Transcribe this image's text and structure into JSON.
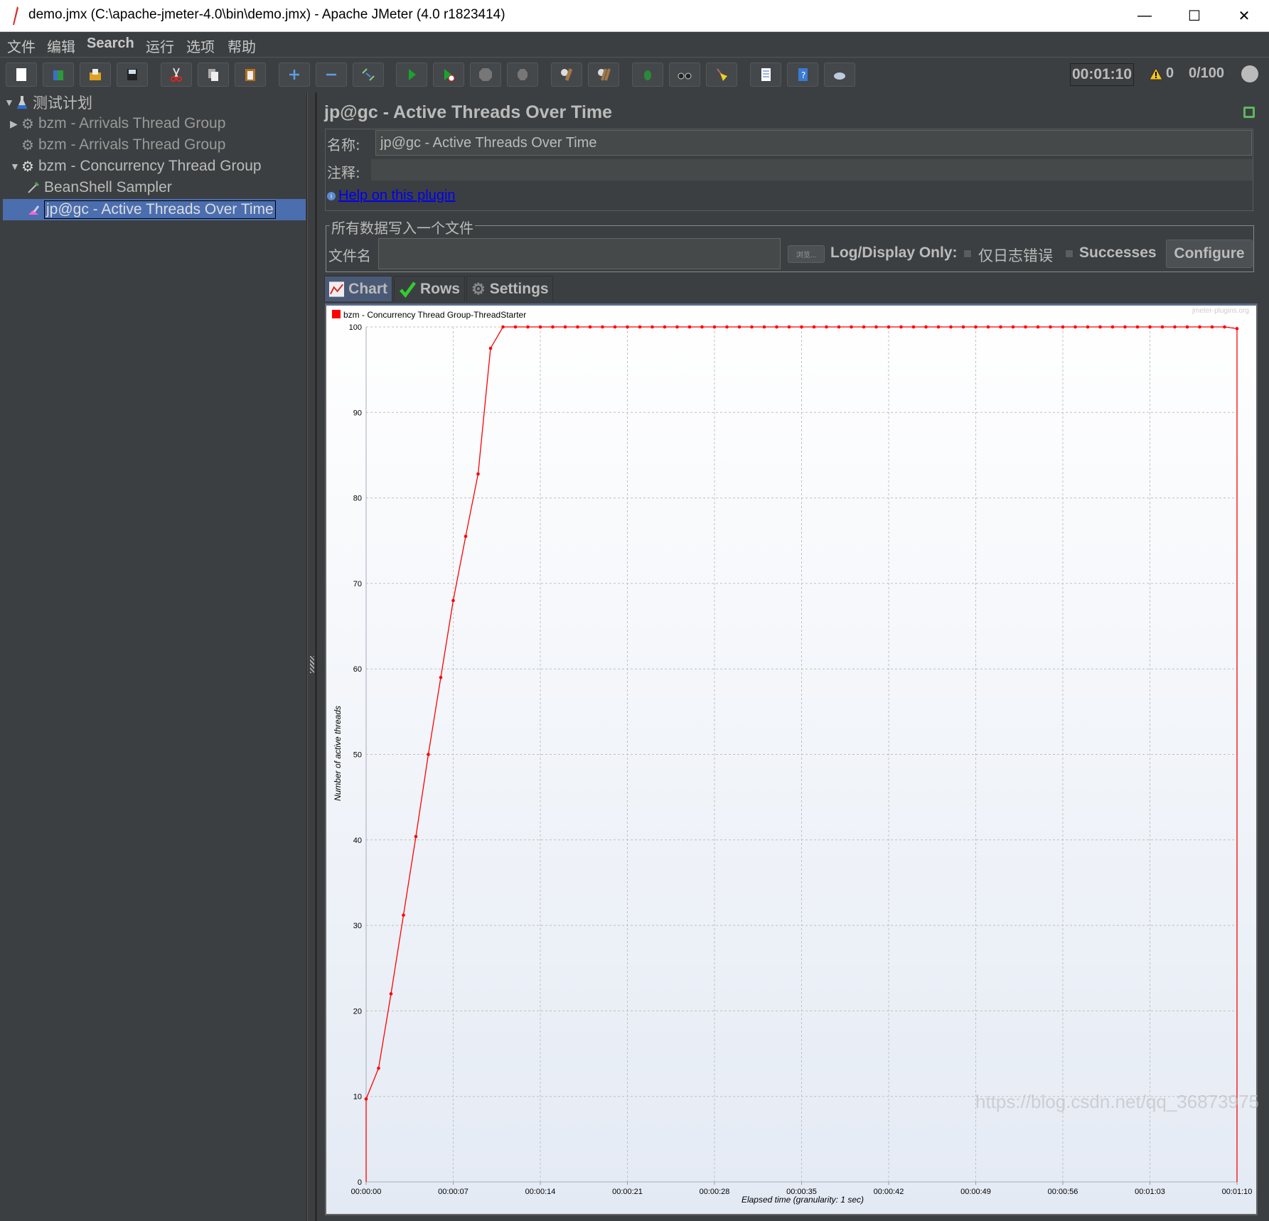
{
  "window": {
    "title": "demo.jmx (C:\\apache-jmeter-4.0\\bin\\demo.jmx) - Apache JMeter (4.0 r1823414)",
    "minimize": "—",
    "maximize": "☐",
    "close": "✕"
  },
  "menu": [
    "文件",
    "编辑",
    "Search",
    "运行",
    "选项",
    "帮助"
  ],
  "toolbar": {
    "buttons": [
      "new-icon",
      "templates-icon",
      "open-icon",
      "save-icon",
      "cut-icon",
      "copy-icon",
      "paste-icon",
      "expand-icon",
      "collapse-icon",
      "toggle-icon",
      "start-icon",
      "start-no-pauses-icon",
      "stop-icon",
      "shutdown-icon",
      "clear-icon",
      "clear-all-icon",
      "function-helper-icon",
      "search-icon",
      "reset-search-icon",
      "log-viewer-icon",
      "help-icon",
      "remote-icon"
    ],
    "timer": "00:01:10",
    "warnings": "0",
    "threads": "0/100"
  },
  "tree": {
    "items": [
      {
        "label": "测试计划",
        "expanded": true
      },
      {
        "label": "bzm - Arrivals Thread Group",
        "expanded": false
      },
      {
        "label": "bzm - Arrivals Thread Group"
      },
      {
        "label": "bzm - Concurrency Thread Group",
        "expanded": true
      },
      {
        "label": "BeanShell Sampler"
      },
      {
        "label": "jp@gc - Active Threads Over Time",
        "selected": true
      }
    ]
  },
  "panel": {
    "title": "jp@gc - Active Threads Over Time",
    "name_label": "名称:",
    "name_value": "jp@gc - Active Threads Over Time",
    "comment_label": "注释:",
    "comment_value": "",
    "help_link": "Help on this plugin",
    "file_section": "所有数据写入一个文件",
    "filename_label": "文件名",
    "filename_value": "",
    "browse": "浏览...",
    "log_display_only": "Log/Display Only:",
    "errors_only": "仅日志错误",
    "successes": "Successes",
    "configure": "Configure",
    "tabs": [
      "Chart",
      "Rows",
      "Settings"
    ]
  },
  "chart_data": {
    "type": "line",
    "title": "",
    "legend": [
      "bzm - Concurrency Thread Group-ThreadStarter"
    ],
    "legend_position": "top-left",
    "series_color": "#ff0000",
    "xlabel": "Elapsed time (granularity: 1 sec)",
    "ylabel": "Number of active threads",
    "xlim": [
      0,
      70
    ],
    "ylim": [
      0,
      100
    ],
    "xticks": [
      "00:00:00",
      "00:00:07",
      "00:00:14",
      "00:00:21",
      "00:00:28",
      "00:00:35",
      "00:00:42",
      "00:00:49",
      "00:00:56",
      "00:01:03",
      "00:01:10"
    ],
    "yticks": [
      0,
      10,
      20,
      30,
      40,
      50,
      60,
      70,
      80,
      90,
      100
    ],
    "grid": true,
    "watermark": "jmeter-plugins.org",
    "series": [
      {
        "name": "bzm - Concurrency Thread Group-ThreadStarter",
        "x": [
          0,
          1,
          2,
          3,
          4,
          5,
          6,
          7,
          8,
          9,
          10,
          11,
          12,
          13,
          14,
          15,
          16,
          17,
          18,
          19,
          20,
          21,
          22,
          23,
          24,
          25,
          26,
          27,
          28,
          29,
          30,
          31,
          32,
          33,
          34,
          35,
          36,
          37,
          38,
          39,
          40,
          41,
          42,
          43,
          44,
          45,
          46,
          47,
          48,
          49,
          50,
          51,
          52,
          53,
          54,
          55,
          56,
          57,
          58,
          59,
          60,
          61,
          62,
          63,
          64,
          65,
          66,
          67,
          68,
          69,
          70
        ],
        "y": [
          9.7,
          13.3,
          22.0,
          31.2,
          40.4,
          50.0,
          59.0,
          68.0,
          75.5,
          82.8,
          97.5,
          100,
          100,
          100,
          100,
          100,
          100,
          100,
          100,
          100,
          100,
          100,
          100,
          100,
          100,
          100,
          100,
          100,
          100,
          100,
          100,
          100,
          100,
          100,
          100,
          100,
          100,
          100,
          100,
          100,
          100,
          100,
          100,
          100,
          100,
          100,
          100,
          100,
          100,
          100,
          100,
          100,
          100,
          100,
          100,
          100,
          100,
          100,
          100,
          100,
          100,
          100,
          100,
          100,
          100,
          100,
          100,
          100,
          100,
          100,
          99.8
        ]
      }
    ]
  },
  "footer_watermark": "https://blog.csdn.net/qq_36873975"
}
